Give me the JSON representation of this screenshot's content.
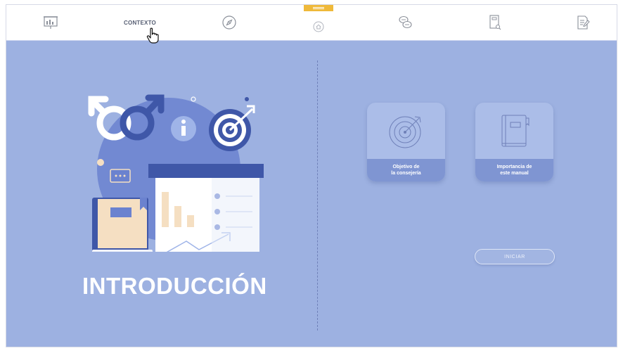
{
  "nav": {
    "items": [
      {
        "icon": "presentation-chart-icon"
      },
      {
        "label": "CONTEXTO"
      },
      {
        "icon": "compass-icon"
      },
      {
        "icon": "home-icon"
      },
      {
        "icon": "chat-bubbles-icon"
      },
      {
        "icon": "book-search-icon"
      },
      {
        "icon": "document-edit-icon"
      }
    ],
    "active_accent": "#efb93a"
  },
  "main": {
    "title": "INTRODUCCIÓN",
    "cards": [
      {
        "line1": "Objetivo de",
        "line2": "la consejería",
        "icon": "target-icon"
      },
      {
        "line1": "Importancia de",
        "line2": "este manual",
        "icon": "book-icon"
      }
    ],
    "start_button": "INICIAR"
  },
  "colors": {
    "background": "#9db1e1",
    "card": "#abbde8",
    "card_label": "#7f95d2",
    "illustration_dark": "#3f57a8",
    "illustration_cream": "#f5dfc2"
  }
}
